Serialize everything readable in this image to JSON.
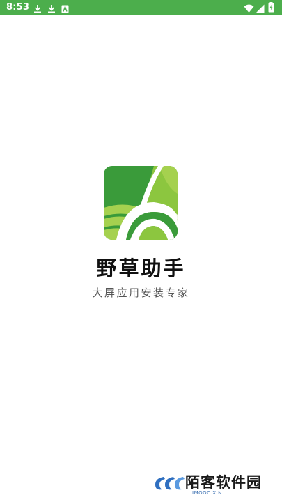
{
  "status_bar": {
    "time": "8:53",
    "background_color": "#4cae4c",
    "icons": [
      "download-icon",
      "download-icon",
      "a-notification-icon",
      "wifi-icon",
      "signal-icon",
      "battery-icon"
    ]
  },
  "splash": {
    "app_name": "野草助手",
    "slogan": "大屏应用安装专家",
    "logo_colors": {
      "dark_green": "#3a9b3a",
      "light_green": "#8cc63f"
    }
  },
  "watermark": {
    "title": "陌客软件园",
    "subtitle": "IMOOC XIN",
    "color": "#2f6fc0"
  }
}
